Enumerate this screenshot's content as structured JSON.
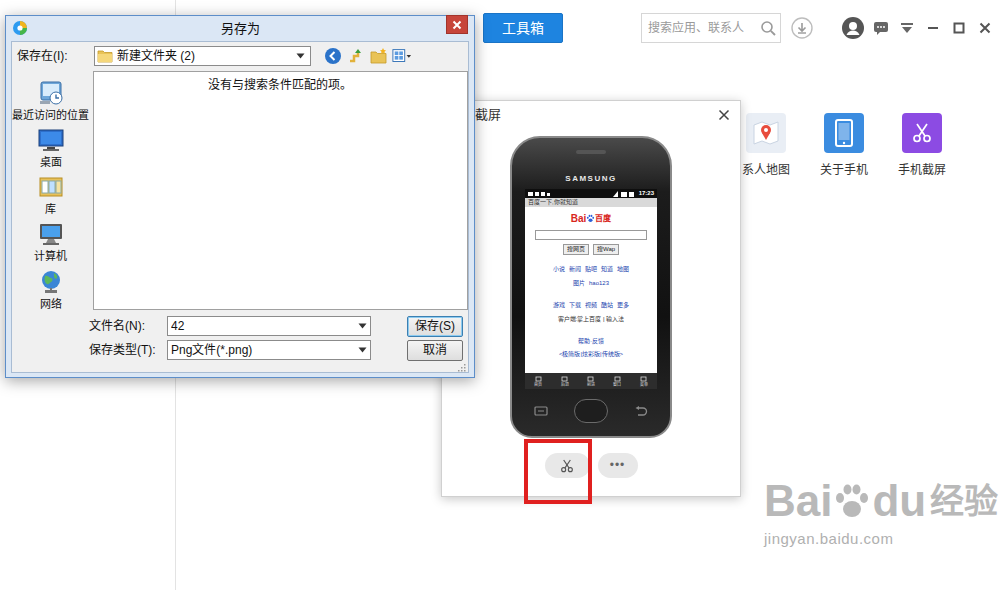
{
  "app": {
    "toolbox_button": "工具箱",
    "search": {
      "placeholder": "搜索应用、联系人"
    },
    "tools": [
      {
        "label": "系人地图",
        "kind": "map"
      },
      {
        "label": "关于手机",
        "kind": "phone"
      },
      {
        "label": "手机截屏",
        "kind": "scissors"
      }
    ]
  },
  "screenshot_window": {
    "title": "截屏",
    "phone": {
      "brand": "SAMSUNG",
      "time": "17:23",
      "page_title": "百度一下,你就知道",
      "logo_latin": "Bai",
      "logo_chinese": "百度",
      "search_buttons": [
        "搜网页",
        "搜Wap"
      ],
      "link_rows": [
        [
          "小说",
          "新闻",
          "贴吧",
          "知道",
          "地图"
        ],
        [
          "图片",
          "hao123"
        ],
        [
          "游戏",
          "下载",
          "视频",
          "酷站",
          "更多"
        ],
        [
          "客户端:掌上百度 | 输入法"
        ],
        [
          "帮助·反馈"
        ],
        [
          "<极简版|炫彩版|传统版>"
        ]
      ],
      "nav": [
        "首页",
        "后退",
        "前进",
        "窗口",
        "菜单"
      ]
    },
    "capture_button": {
      "highlighted": true
    },
    "more_button": {
      "label": "•••"
    }
  },
  "save_dialog": {
    "title": "另存为",
    "save_in_label": "保存在(I):",
    "location": "新建文件夹 (2)",
    "places": [
      {
        "label": "最近访问的位置",
        "kind": "recent"
      },
      {
        "label": "桌面",
        "kind": "desktop"
      },
      {
        "label": "库",
        "kind": "library"
      },
      {
        "label": "计算机",
        "kind": "computer"
      },
      {
        "label": "网络",
        "kind": "network"
      }
    ],
    "empty_message": "没有与搜索条件匹配的项。",
    "filename_label": "文件名(N):",
    "filename": "42",
    "type_label": "保存类型(T):",
    "file_type": "Png文件(*.png)",
    "save_button": "保存(S)",
    "cancel_button": "取消"
  },
  "watermark": {
    "brand_left": "Bai",
    "brand_right": "du",
    "product": "经验",
    "url": "jingyan.baidu.com"
  }
}
